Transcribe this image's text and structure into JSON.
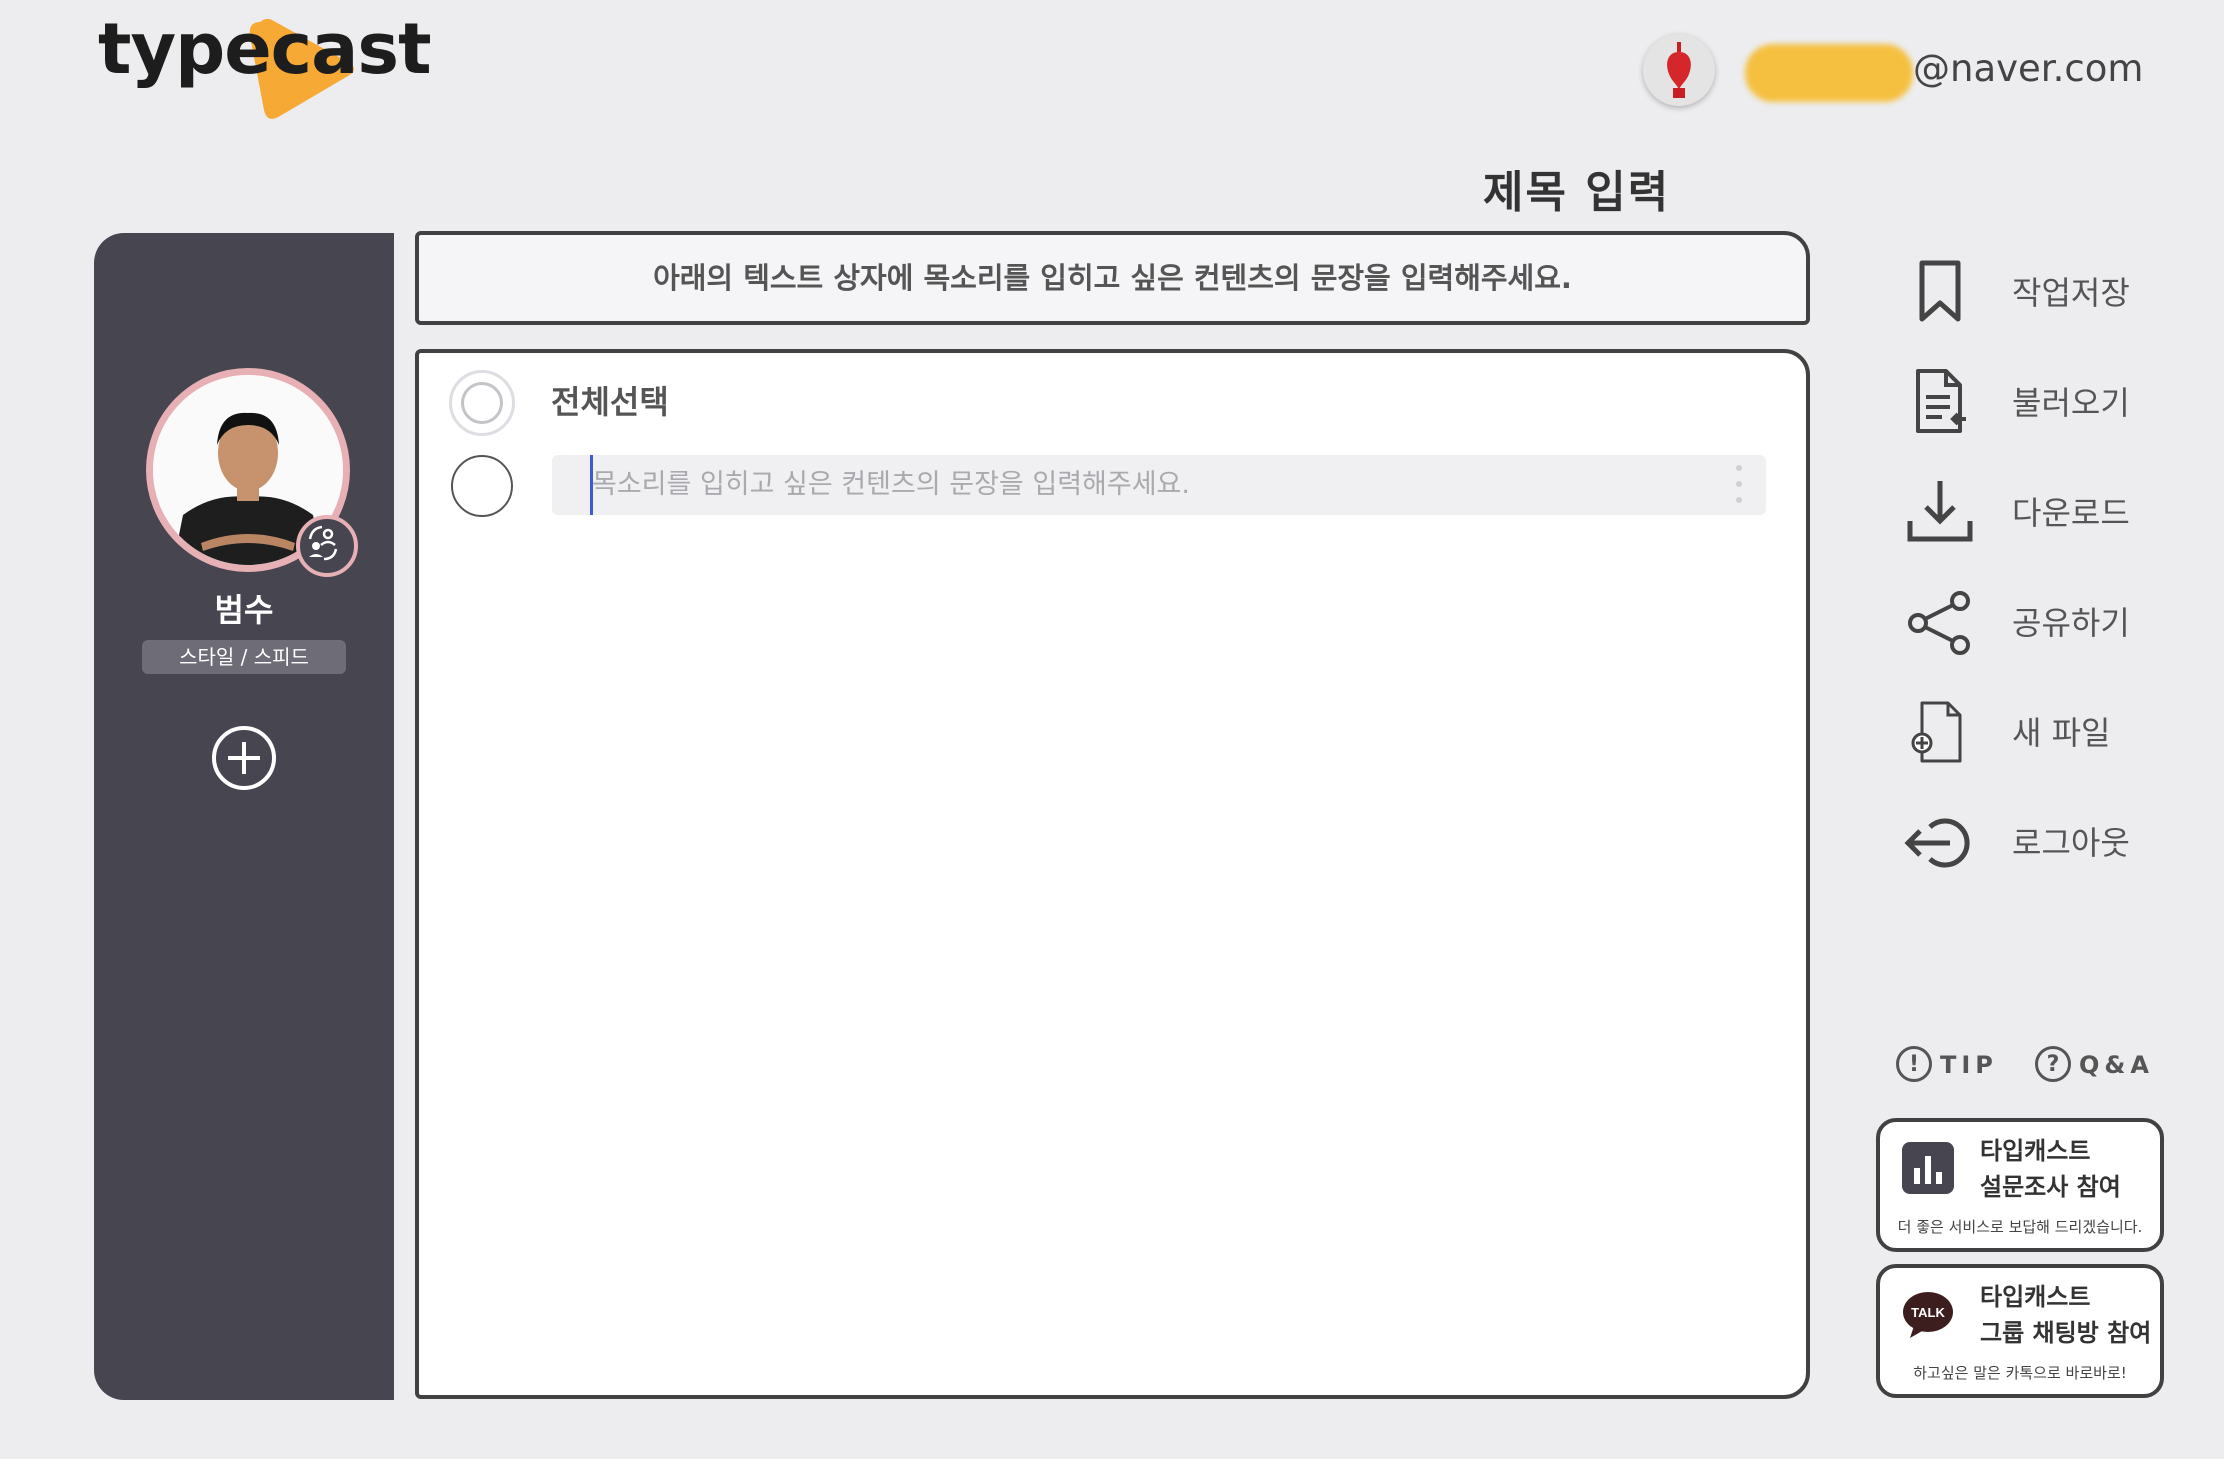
{
  "brand": {
    "logo_text": "typecast",
    "accent": "#f7a935"
  },
  "header": {
    "email_suffix": "@naver.com",
    "project_title": "제목 입력"
  },
  "actor": {
    "name": "범수",
    "style_speed_label": "스타일 / 스피드",
    "avatar_border_color": "#e7b0b4"
  },
  "editor": {
    "instruction": "아래의 텍스트 상자에 목소리를 입히고 싶은 컨텐츠의 문장을 입력해주세요.",
    "select_all_label": "전체선택",
    "sentence_placeholder": "목소리를 입히고 싶은 컨텐츠의 문장을 입력해주세요."
  },
  "menu": {
    "items": [
      {
        "label": "작업저장",
        "icon": "bookmark-icon"
      },
      {
        "label": "불러오기",
        "icon": "load-document-icon"
      },
      {
        "label": "다운로드",
        "icon": "download-icon"
      },
      {
        "label": "공유하기",
        "icon": "share-icon"
      },
      {
        "label": "새 파일",
        "icon": "new-file-icon"
      },
      {
        "label": "로그아웃",
        "icon": "logout-icon"
      }
    ]
  },
  "help": {
    "tip_label": "TIP",
    "qna_label": "Q&A"
  },
  "promos": [
    {
      "line1": "타입캐스트",
      "line2": "설문조사 참여",
      "sub": "더 좋은 서비스로 보답해 드리겠습니다.",
      "icon": "survey-chart-icon"
    },
    {
      "line1": "타입캐스트",
      "line2": "그룹 채팅방 참여",
      "sub": "하고싶은 말은 카톡으로 바로바로!",
      "icon": "kakao-talk-icon",
      "icon_text": "TALK"
    }
  ]
}
